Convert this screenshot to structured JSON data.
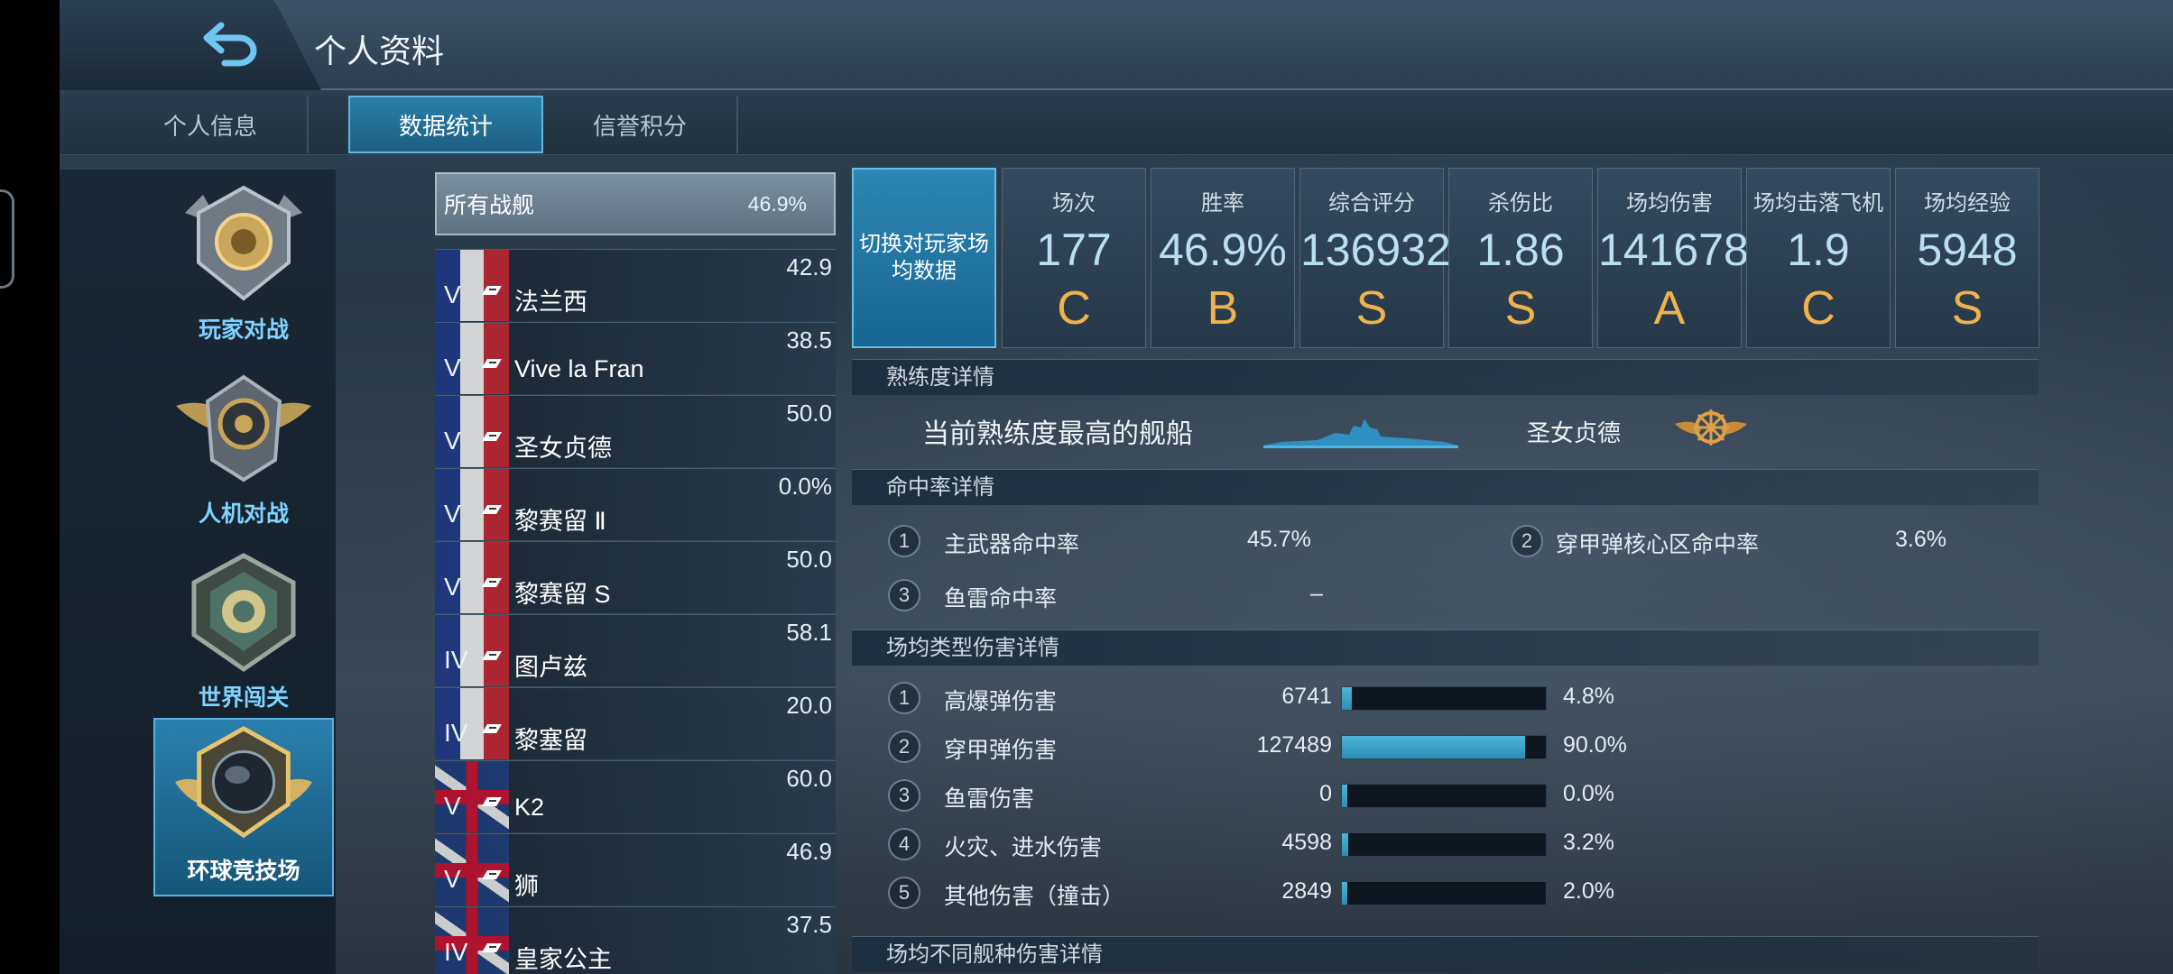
{
  "header": {
    "title": "个人资料"
  },
  "tabs": [
    {
      "label": "个人信息"
    },
    {
      "label": "数据统计"
    },
    {
      "label": "信誉积分"
    }
  ],
  "modes": [
    {
      "label": "玩家对战"
    },
    {
      "label": "人机对战"
    },
    {
      "label": "世界闯关"
    },
    {
      "label": "环球竞技场"
    }
  ],
  "ship_list": {
    "all": {
      "label": "所有战舰",
      "value": "46.9%"
    },
    "rows": [
      {
        "tier": "V",
        "name": "法兰西",
        "value": "42.9",
        "flag": "fr"
      },
      {
        "tier": "V",
        "name": "Vive la Fran",
        "value": "38.5",
        "flag": "fr"
      },
      {
        "tier": "V",
        "name": "圣女贞德",
        "value": "50.0",
        "flag": "fr"
      },
      {
        "tier": "V",
        "name": "黎赛留 Ⅱ",
        "value": "0.0%",
        "flag": "fr"
      },
      {
        "tier": "V",
        "name": "黎赛留 S",
        "value": "50.0",
        "flag": "fr"
      },
      {
        "tier": "IV",
        "name": "图卢兹",
        "value": "58.1",
        "flag": "fr"
      },
      {
        "tier": "IV",
        "name": "黎塞留",
        "value": "20.0",
        "flag": "fr"
      },
      {
        "tier": "V",
        "name": "K2",
        "value": "60.0",
        "flag": "uk"
      },
      {
        "tier": "V",
        "name": "狮",
        "value": "46.9",
        "flag": "uk"
      },
      {
        "tier": "IV",
        "name": "皇家公主",
        "value": "37.5",
        "flag": "uk"
      }
    ]
  },
  "summary": {
    "switch_label": "切换对玩家场均数据",
    "stats": [
      {
        "label": "场次",
        "value": "177",
        "grade": "C"
      },
      {
        "label": "胜率",
        "value": "46.9%",
        "grade": "B"
      },
      {
        "label": "综合评分",
        "value": "136932",
        "grade": "S"
      },
      {
        "label": "杀伤比",
        "value": "1.86",
        "grade": "S"
      },
      {
        "label": "场均伤害",
        "value": "141678",
        "grade": "A"
      },
      {
        "label": "场均击落飞机",
        "value": "1.9",
        "grade": "C"
      },
      {
        "label": "场均经验",
        "value": "5948",
        "grade": "S"
      }
    ]
  },
  "proficiency": {
    "title": "熟练度详情",
    "label": "当前熟练度最高的舰船",
    "ship": "圣女贞德"
  },
  "accuracy": {
    "title": "命中率详情",
    "rows": [
      {
        "num": "1",
        "label": "主武器命中率",
        "value": "45.7%"
      },
      {
        "num": "2",
        "label": "穿甲弹核心区命中率",
        "value": "3.6%"
      },
      {
        "num": "3",
        "label": "鱼雷命中率",
        "value": "–"
      }
    ]
  },
  "damage_types": {
    "title": "场均类型伤害详情",
    "rows": [
      {
        "num": "1",
        "label": "高爆弹伤害",
        "value": "6741",
        "percent": "4.8%",
        "fraction": 0.048
      },
      {
        "num": "2",
        "label": "穿甲弹伤害",
        "value": "127489",
        "percent": "90.0%",
        "fraction": 0.9
      },
      {
        "num": "3",
        "label": "鱼雷伤害",
        "value": "0",
        "percent": "0.0%",
        "fraction": 0.0
      },
      {
        "num": "4",
        "label": "火灾、进水伤害",
        "value": "4598",
        "percent": "3.2%",
        "fraction": 0.032
      },
      {
        "num": "5",
        "label": "其他伤害（撞击）",
        "value": "2849",
        "percent": "2.0%",
        "fraction": 0.02
      }
    ]
  },
  "ship_class_damage": {
    "title": "场均不同舰种伤害详情"
  },
  "colors": {
    "accent": "#2a7fa8",
    "grade": "#f0b24d",
    "bar": "#3aa3c8"
  }
}
